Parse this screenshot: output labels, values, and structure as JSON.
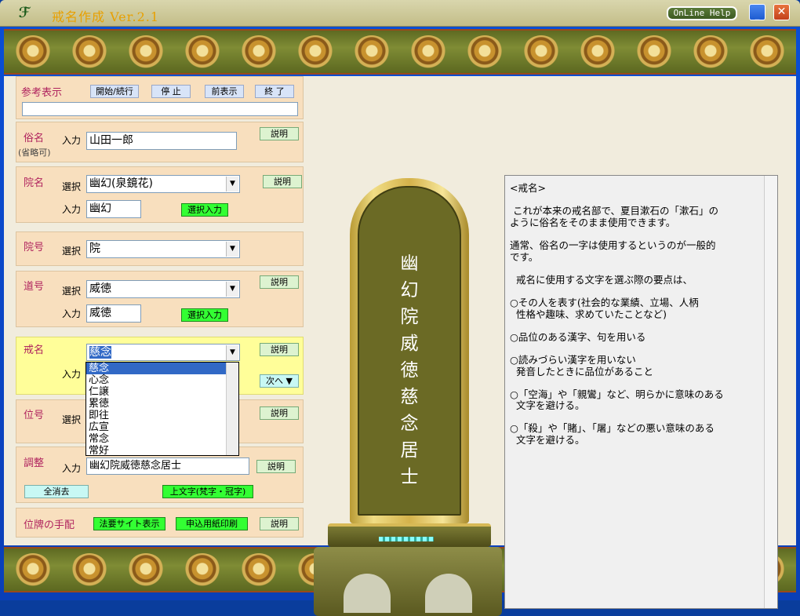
{
  "window": {
    "title": "戒名作成  Ver.2.1",
    "help": "OnLine Help",
    "min": "_",
    "close": "✕"
  },
  "reference": {
    "label": "参考表示",
    "start": "開始/続行",
    "stop": "停 止",
    "prev": "前表示",
    "end": "終 了",
    "value": ""
  },
  "zokumyo": {
    "label": "俗名",
    "sub": "(省略可)",
    "input_label": "入力",
    "value": "山田一郎",
    "explain": "説明"
  },
  "ingo": {
    "label": "院名",
    "select_label": "選択",
    "selected": "幽幻(泉鏡花)",
    "input_label": "入力",
    "value": "幽幻",
    "select_input": "選択入力",
    "explain": "説明"
  },
  "ingo2": {
    "label": "院号",
    "select_label": "選択",
    "selected": "院"
  },
  "dogo": {
    "label": "道号",
    "select_label": "選択",
    "selected": "威徳",
    "input_label": "入力",
    "value": "威徳",
    "select_input": "選択入力",
    "explain": "説明"
  },
  "kaimyo": {
    "label": "戒名",
    "input_label": "入力",
    "selected": "慈念",
    "explain": "説明",
    "next": "次へ ▼",
    "options": [
      "慈念",
      "心念",
      "仁譲",
      "累徳",
      "即往",
      "広宣",
      "常念",
      "常好"
    ]
  },
  "igo": {
    "label": "位号",
    "select_label": "選択",
    "explain": "説明"
  },
  "adjust": {
    "label": "調整",
    "input_label": "入力",
    "value": "幽幻院威徳慈念居士",
    "explain": "説明",
    "clear": "全消去",
    "upper": "上文字(梵字・冠字)"
  },
  "ihai": {
    "label": "位牌の手配",
    "site": "法要サイト表示",
    "print": "申込用紙印刷",
    "explain": "説明"
  },
  "tablet": {
    "chars": [
      "幽",
      "幻",
      "院",
      "威",
      "徳",
      "慈",
      "念",
      "居",
      "士"
    ]
  },
  "note": {
    "text": "<戒名>\n\n これが本来の戒名部で、夏目漱石の「漱石」の\nように俗名をそのまま使用できます。\n\n通常、俗名の一字は使用するというのが一般的\nです。\n\n  戒名に使用する文字を選ぶ際の要点は、\n\n○その人を表す(社会的な業績、立場、人柄\n  性格や趣味、求めていたことなど)\n\n○品位のある漢字、句を用いる\n\n○読みづらい漢字を用いない\n  発音したときに品位があること\n\n○「空海」や「親鸞」など、明らかに意味のある\n  文字を避ける。\n\n○「殺」や「賭」、「屠」などの悪い意味のある\n  文字を避ける。"
  },
  "colors": {
    "accent": "#b0245e",
    "titlebar": "#c8c290",
    "band": "#6b7a28"
  }
}
